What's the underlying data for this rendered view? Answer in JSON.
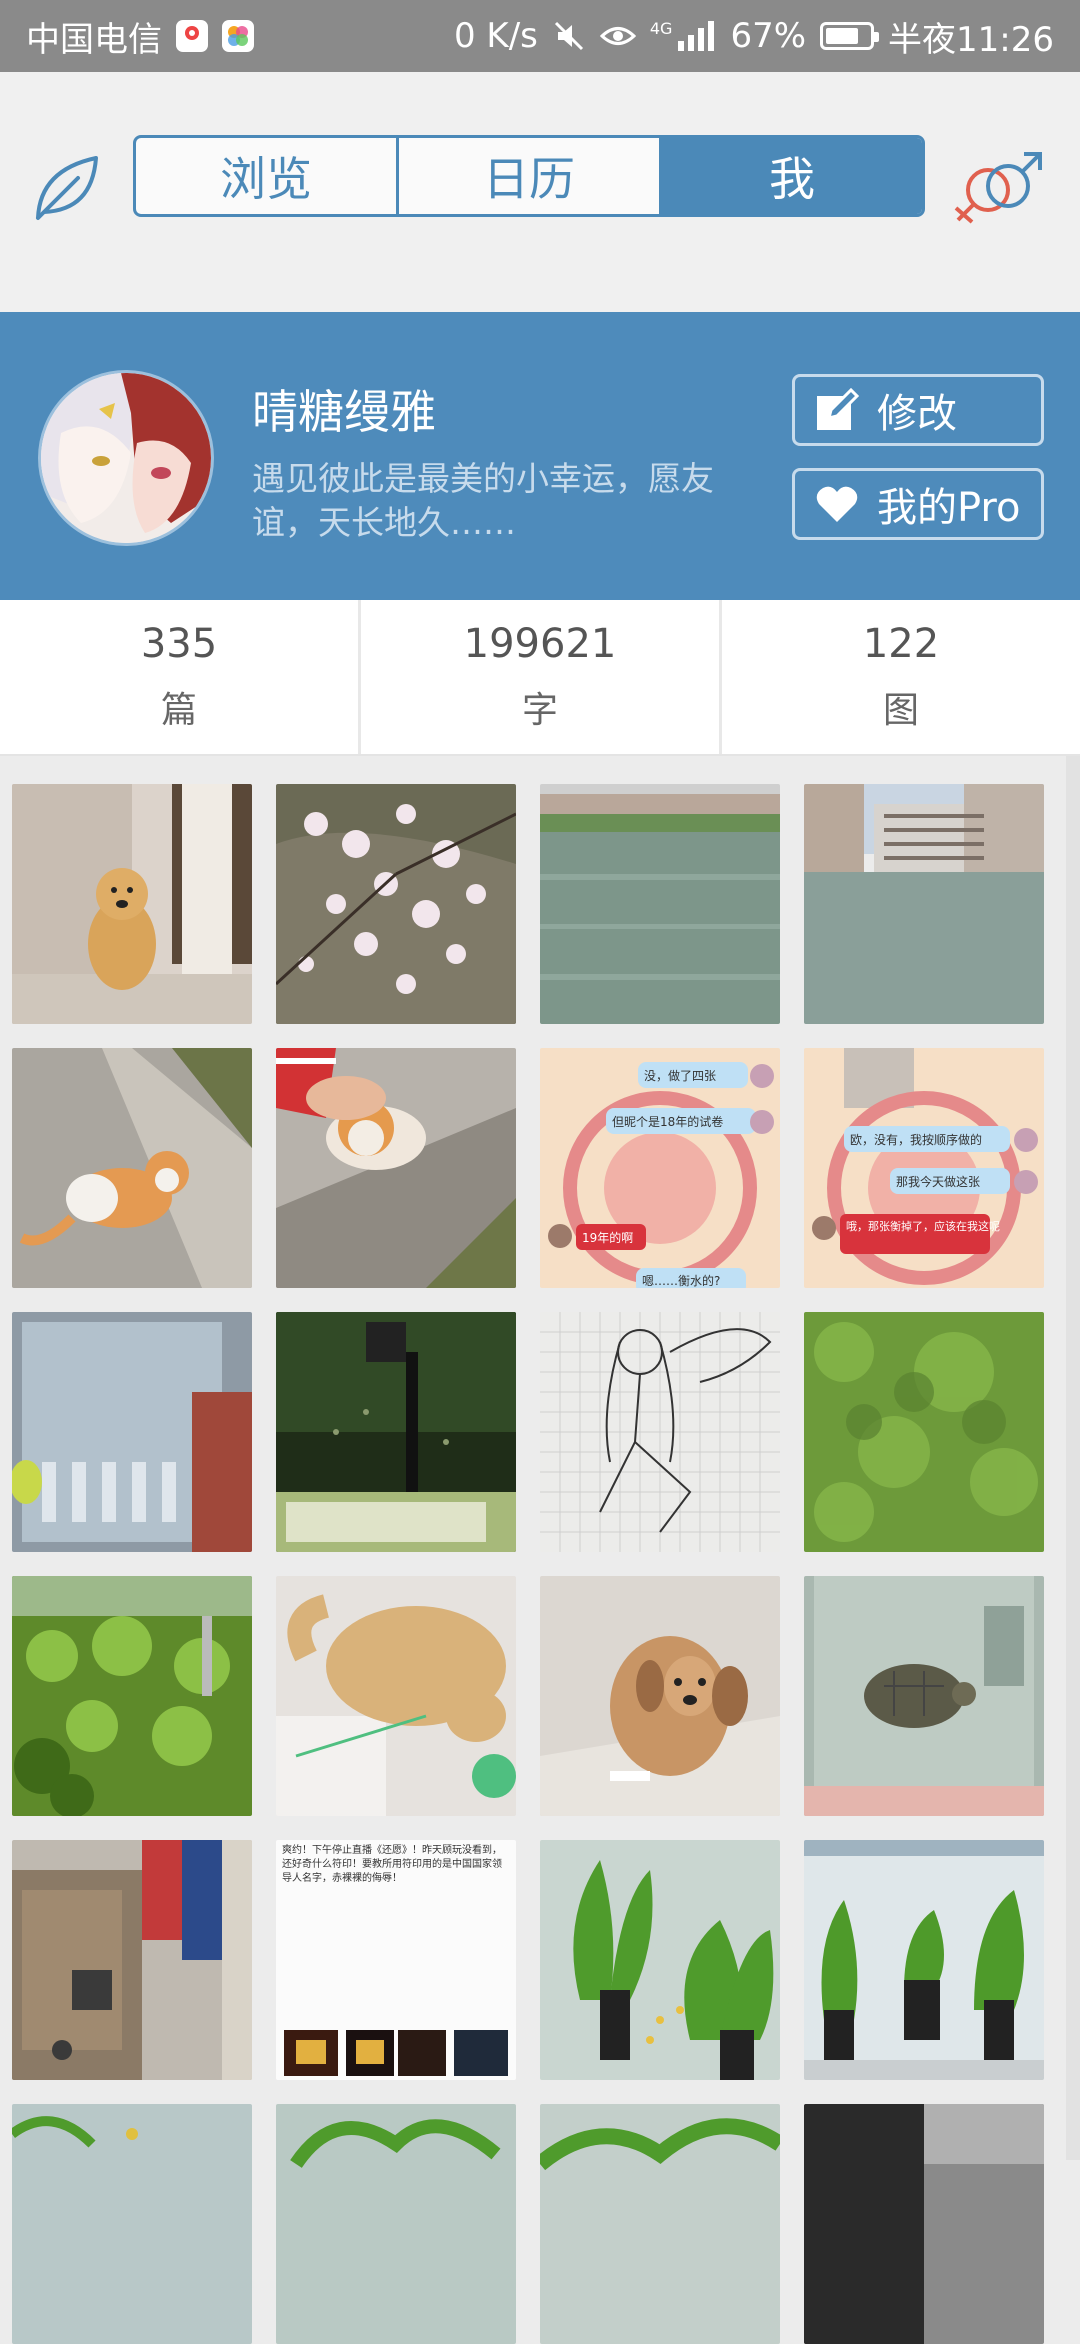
{
  "status_bar": {
    "carrier": "中国电信",
    "speed": "0 K/s",
    "network": "4G",
    "battery": "67%",
    "time": "半夜11:26"
  },
  "nav": {
    "tabs": [
      {
        "label": "浏览",
        "active": false
      },
      {
        "label": "日历",
        "active": false
      },
      {
        "label": "我",
        "active": true
      }
    ],
    "left_icon": "leaf-icon",
    "right_icon": "gender-icon"
  },
  "profile": {
    "name": "晴糖缦雅",
    "bio": "遇见彼此是最美的小幸运，愿友谊，天长地久……",
    "edit_label": "修改",
    "pro_label": "我的Pro"
  },
  "stats": [
    {
      "value": "335",
      "unit": "篇"
    },
    {
      "value": "199621",
      "unit": "字"
    },
    {
      "value": "122",
      "unit": "图"
    }
  ],
  "gallery": {
    "items": [
      {
        "subject": "golden retriever puppy"
      },
      {
        "subject": "cherry blossoms"
      },
      {
        "subject": "lake"
      },
      {
        "subject": "lake with buildings"
      },
      {
        "subject": "orange white cat on sidewalk"
      },
      {
        "subject": "cat being petted"
      },
      {
        "subject": "chat screenshot"
      },
      {
        "subject": "chat screenshot"
      },
      {
        "subject": "plastic container"
      },
      {
        "subject": "fish tank"
      },
      {
        "subject": "anime sketch"
      },
      {
        "subject": "algae water"
      },
      {
        "subject": "aquarium plants"
      },
      {
        "subject": "sleeping dog"
      },
      {
        "subject": "dog on floor"
      },
      {
        "subject": "turtle in tank"
      },
      {
        "subject": "room with clothes"
      },
      {
        "subject": "text post screenshot"
      },
      {
        "subject": "aquarium plants"
      },
      {
        "subject": "aquarium plants"
      },
      {
        "subject": "aquarium"
      },
      {
        "subject": "aquarium"
      },
      {
        "subject": "aquarium"
      },
      {
        "subject": "aquarium"
      }
    ],
    "chat_texts": {
      "a1": "没，做了四张",
      "a2": "但昵个是18年的试卷",
      "a3": "19年的啊",
      "a4": "嗯……衡水的?",
      "b1": "欧，没有，我按顺序做的",
      "b2": "那我今天做这张",
      "b3": "哦，那张衡掉了，应该在我这呢"
    },
    "post_text": "爽约！下午停止直播《还愿》！昨天顾玩没看到，还好奇什么符印！要教所用符印用的是中国国家领导人名字，赤裸裸的侮辱！"
  },
  "colors": {
    "accent": "#4e8bbb",
    "status_bar": "#8a8a8a"
  }
}
